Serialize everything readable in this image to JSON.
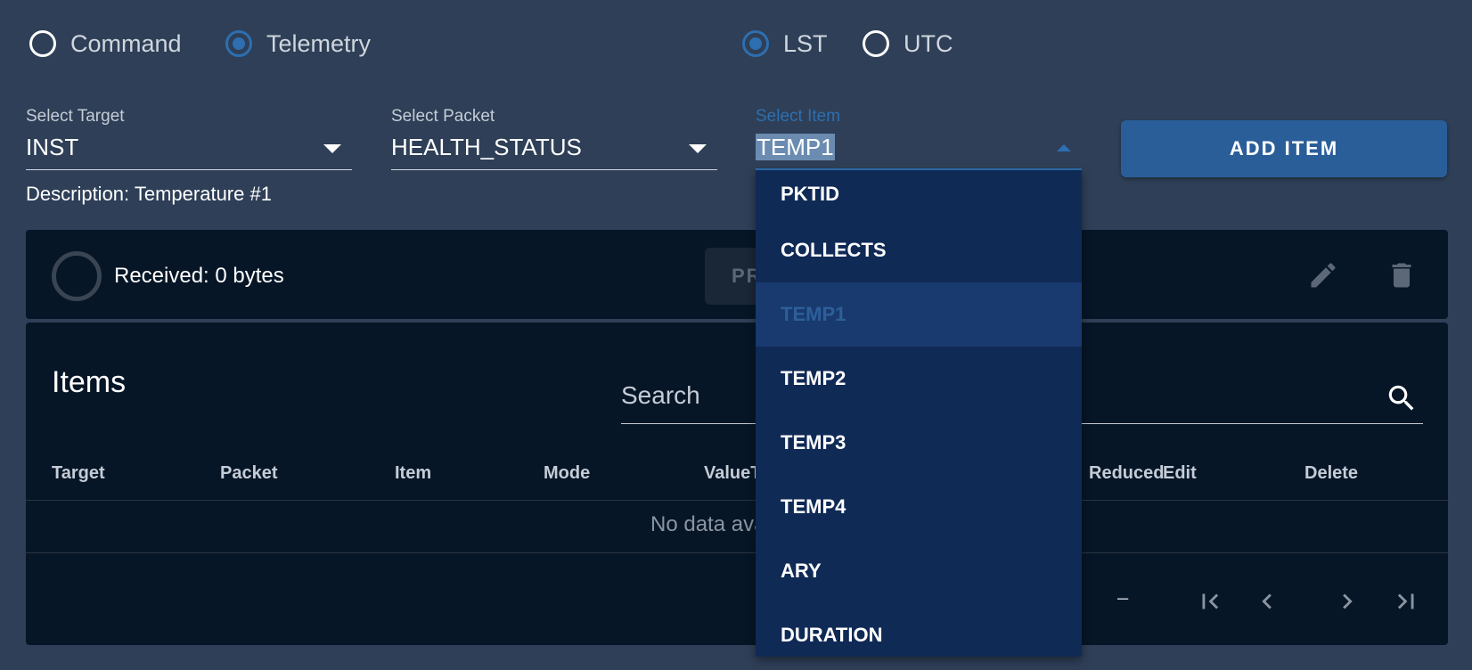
{
  "modes": {
    "command": "Command",
    "telemetry": "Telemetry",
    "selected": "Telemetry"
  },
  "time_format": {
    "lst": "LST",
    "utc": "UTC",
    "selected": "LST"
  },
  "target_select": {
    "label": "Select Target",
    "value": "INST"
  },
  "packet_select": {
    "label": "Select Packet",
    "value": "HEALTH_STATUS"
  },
  "item_select": {
    "label": "Select Item",
    "value": "TEMP1",
    "options": [
      "PKTID",
      "COLLECTS",
      "TEMP1",
      "TEMP2",
      "TEMP3",
      "TEMP4",
      "ARY",
      "DURATION"
    ],
    "highlighted": "TEMP1"
  },
  "add_item_button": "ADD ITEM",
  "description": "Description: Temperature #1",
  "toolbar": {
    "received": "Received: 0 bytes",
    "process_button": "PROCESS"
  },
  "items_table": {
    "title": "Items",
    "search_placeholder": "Search",
    "columns": [
      "Target",
      "Packet",
      "Item",
      "Mode",
      "ValueType",
      "Reduced",
      "Edit",
      "Delete"
    ],
    "empty_text": "No data available",
    "pagination_text": "–"
  },
  "colors": {
    "page_bg": "#2e3f57",
    "panel_bg": "#061627",
    "accent": "#2d6fb0",
    "button": "#2a5e99",
    "menu_bg": "#102a56",
    "menu_active_bg": "#183a6e"
  },
  "icons": [
    "pencil-icon",
    "trash-icon",
    "search-icon",
    "page-first-icon",
    "chevron-left-icon",
    "chevron-right-icon",
    "page-last-icon",
    "menu-up-icon",
    "menu-down-icon"
  ]
}
